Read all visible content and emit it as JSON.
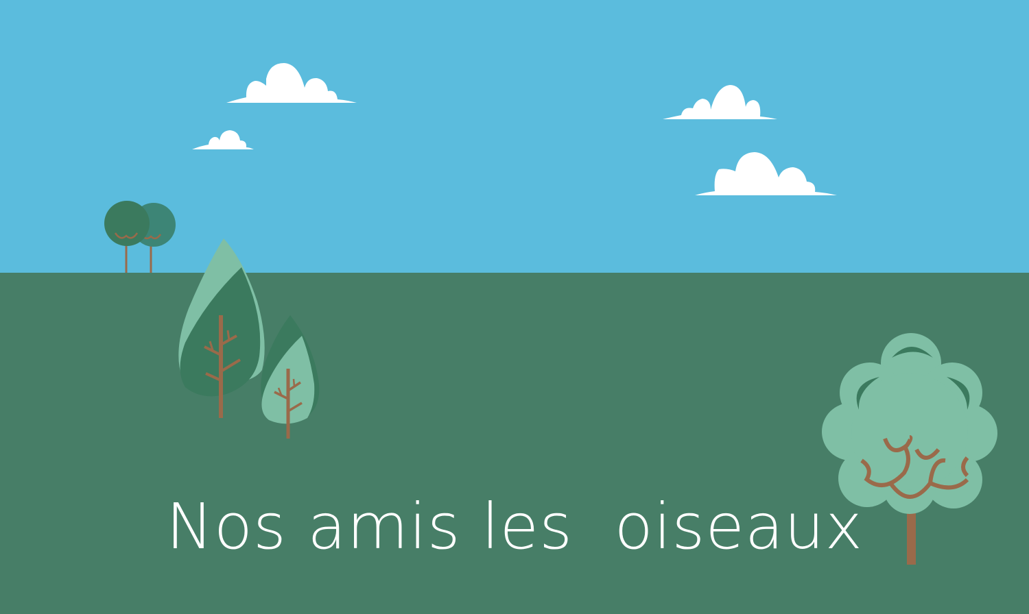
{
  "scene": {
    "title": "Nos amis les  oiseaux",
    "colors": {
      "sky": "#5bbcdd",
      "ground": "#477e67",
      "cloud": "#ffffff",
      "leaf_light": "#7fbfa5",
      "leaf_dark": "#3b7a5e",
      "leaf_mid": "#3d8576",
      "trunk": "#9a6a4a",
      "title": "#ffffff"
    },
    "icons": [
      "cloud-icon",
      "tree-icon"
    ]
  }
}
